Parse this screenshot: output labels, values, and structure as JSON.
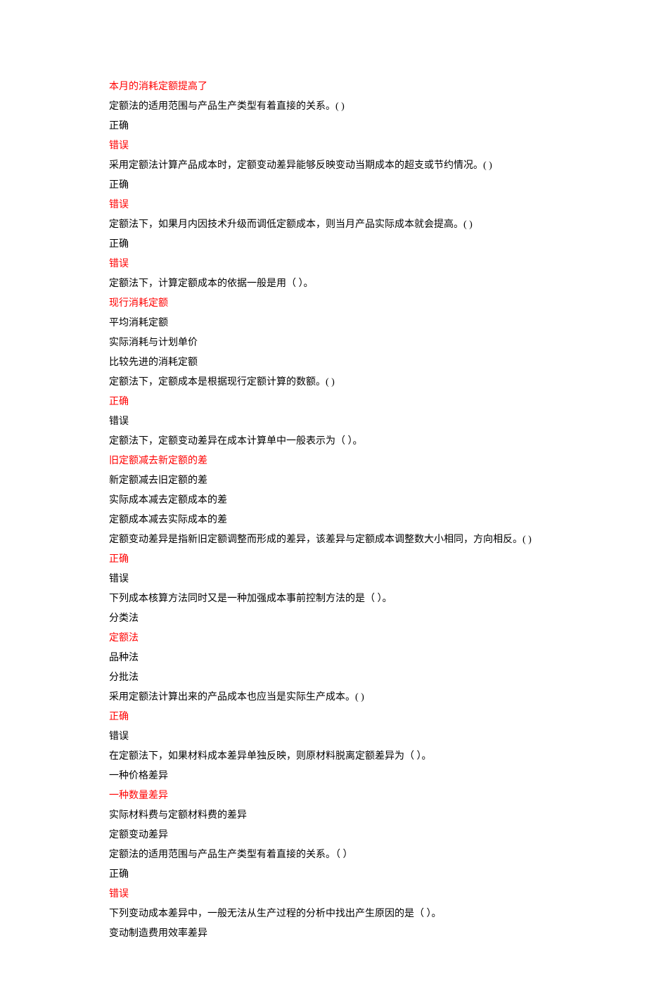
{
  "items": [
    {
      "text": "本月的消耗定额提高了",
      "style": "red"
    },
    {
      "text": "定额法的适用范围与产品生产类型有着直接的关系。(   )",
      "style": "black"
    },
    {
      "text": "正确",
      "style": "black"
    },
    {
      "text": "错误",
      "style": "red"
    },
    {
      "text": "采用定额法计算产品成本时，定额变动差异能够反映变动当期成本的超支或节约情况。(   )",
      "style": "black"
    },
    {
      "text": "正确",
      "style": "black"
    },
    {
      "text": "错误",
      "style": "red"
    },
    {
      "text": "定额法下，如果月内因技术升级而调低定额成本，则当月产品实际成本就会提高。(   )",
      "style": "black"
    },
    {
      "text": "正确",
      "style": "black"
    },
    {
      "text": "错误",
      "style": "red"
    },
    {
      "text": "定额法下，计算定额成本的依据一般是用（  ）。",
      "style": "black"
    },
    {
      "text": "现行消耗定额",
      "style": "red"
    },
    {
      "text": "平均消耗定额",
      "style": "black"
    },
    {
      "text": "实际消耗与计划单价",
      "style": "black"
    },
    {
      "text": "比较先进的消耗定额",
      "style": "black"
    },
    {
      "text": "定额法下，定额成本是根据现行定额计算的数额。(   )",
      "style": "black"
    },
    {
      "text": "正确",
      "style": "red"
    },
    {
      "text": "错误",
      "style": "black"
    },
    {
      "text": "定额法下，定额变动差异在成本计算单中一般表示为（  ）。",
      "style": "black"
    },
    {
      "text": "旧定额减去新定额的差",
      "style": "red"
    },
    {
      "text": "新定额减去旧定额的差",
      "style": "black"
    },
    {
      "text": "实际成本减去定额成本的差",
      "style": "black"
    },
    {
      "text": "定额成本减去实际成本的差",
      "style": "black"
    },
    {
      "text": "定额变动差异是指新旧定额调整而形成的差异，该差异与定额成本调整数大小相同，方向相反。(   )",
      "style": "black"
    },
    {
      "text": "正确",
      "style": "red"
    },
    {
      "text": "错误",
      "style": "black"
    },
    {
      "text": "下列成本核算方法同时又是一种加强成本事前控制方法的是（  ）。",
      "style": "black"
    },
    {
      "text": "分类法",
      "style": "black"
    },
    {
      "text": "定额法",
      "style": "red"
    },
    {
      "text": "品种法",
      "style": "black"
    },
    {
      "text": "分批法",
      "style": "black"
    },
    {
      "text": "采用定额法计算出来的产品成本也应当是实际生产成本。(   )",
      "style": "black"
    },
    {
      "text": "正确",
      "style": "red"
    },
    {
      "text": "错误",
      "style": "black"
    },
    {
      "text": "在定额法下，如果材料成本差异单独反映，则原材料脱离定额差异为（  ）。",
      "style": "black"
    },
    {
      "text": "一种价格差异",
      "style": "black"
    },
    {
      "text": "一种数量差异",
      "style": "red"
    },
    {
      "text": "实际材料费与定额材料费的差异",
      "style": "black"
    },
    {
      "text": "定额变动差异",
      "style": "black"
    },
    {
      "text": "定额法的适用范围与产品生产类型有着直接的关系。（   ）",
      "style": "black"
    },
    {
      "text": "正确",
      "style": "black"
    },
    {
      "text": "错误",
      "style": "red"
    },
    {
      "text": "下列变动成本差异中，一般无法从生产过程的分析中找出产生原因的是（  ）。",
      "style": "black"
    },
    {
      "text": "变动制造费用效率差异",
      "style": "black"
    }
  ]
}
